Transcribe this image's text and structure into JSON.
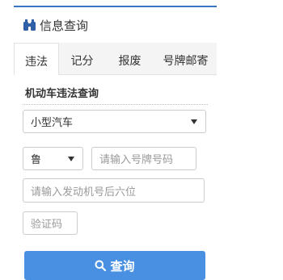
{
  "header": {
    "title": "信息查询",
    "icon": "binoculars-icon",
    "accent": "#3b72c1"
  },
  "tabs": [
    {
      "label": "违法",
      "active": true
    },
    {
      "label": "记分",
      "active": false
    },
    {
      "label": "报废",
      "active": false
    },
    {
      "label": "号牌邮寄",
      "active": false
    }
  ],
  "form": {
    "section_title": "机动车违法查询",
    "vehicle_type": "小型汽车",
    "province": "鲁",
    "plate_placeholder": "请输入号牌号码",
    "engine_placeholder": "请输入发动机号后六位",
    "captcha_placeholder": "验证码",
    "submit_label": "查询",
    "button_color": "#4a90e2"
  }
}
